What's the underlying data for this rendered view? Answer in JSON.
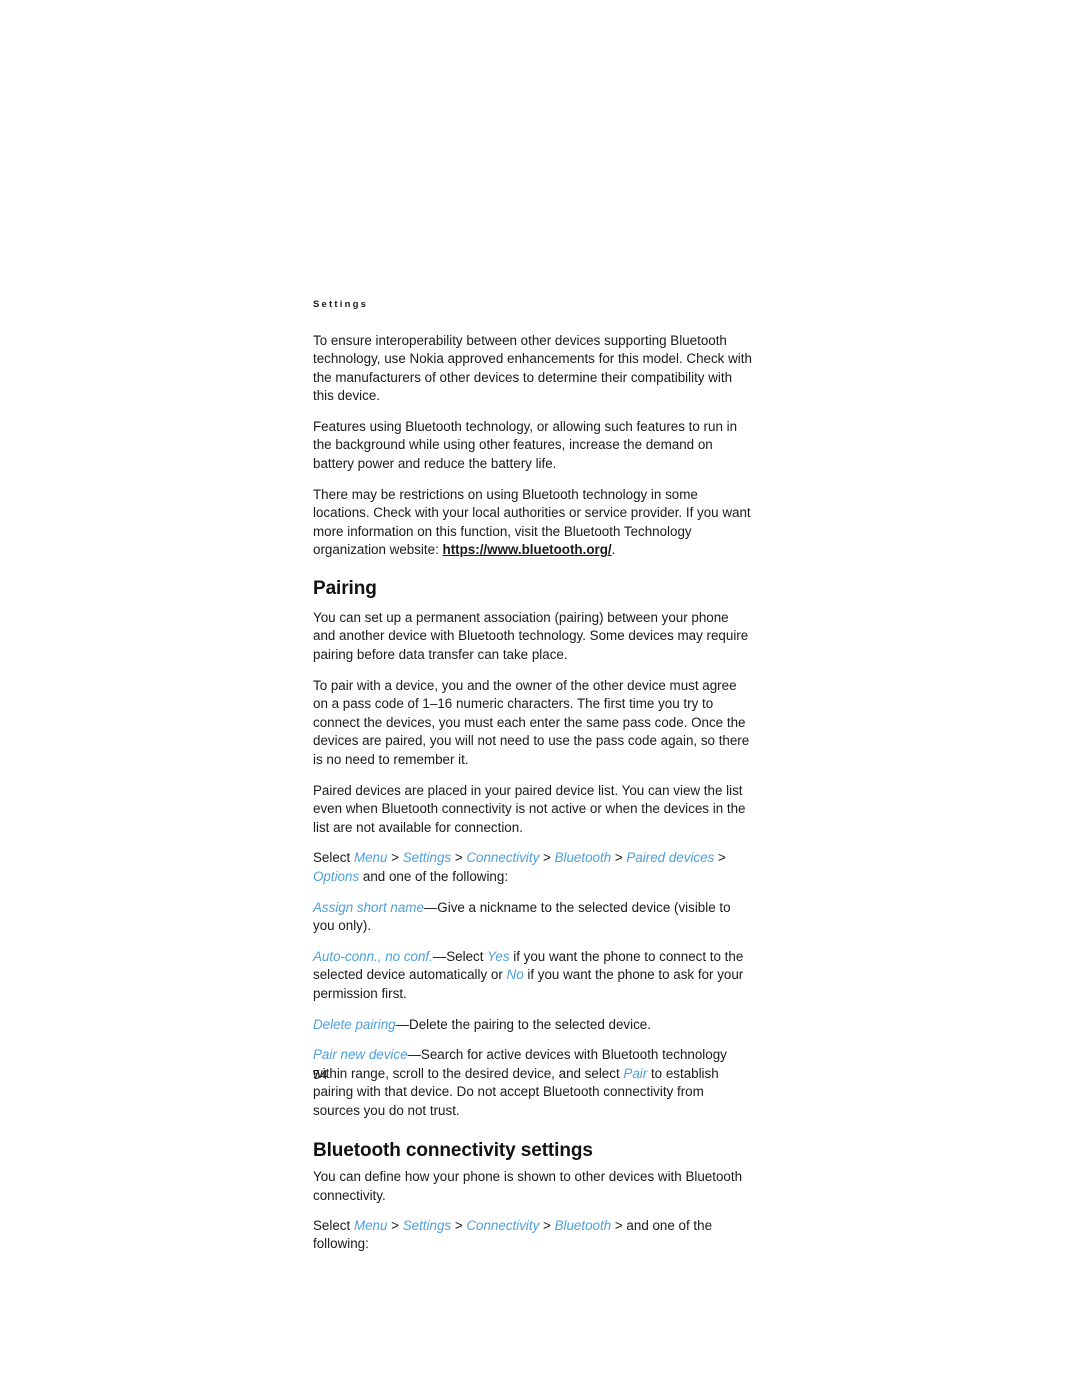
{
  "page": {
    "running_header": "Settings",
    "page_number": "54",
    "accent_color": "#4d9fdb",
    "text_color": "#1a1a1a"
  },
  "paragraphs": {
    "interoperability": "To ensure interoperability between other devices supporting Bluetooth technology, use Nokia approved enhancements for this model. Check with the manufacturers of other devices to determine their compatibility with this device.",
    "features_battery": "Features using Bluetooth technology, or allowing such features to run in the background while using other features, increase the demand on battery power and reduce the battery life.",
    "restrictions_prefix": "There may be restrictions on using Bluetooth technology in some locations. Check with your local authorities or service provider. If you want more information on this function, visit the Bluetooth Technology organization website: ",
    "restrictions_url": "https://www.bluetooth.org/",
    "restrictions_suffix": ".",
    "pairing_intro": "You can set up a permanent association (pairing) between your phone and another device with Bluetooth technology. Some devices may require pairing before data transfer can take place.",
    "pass_code": "To pair with a device, you and the owner of the other device must agree on a pass code of 1–16 numeric characters. The first time you try to connect the devices, you must each enter the same pass code. Once the devices are paired, you will not need to use the pass code again, so there is no need to remember it.",
    "paired_list": "Paired devices are placed in your paired device list. You can view the list even when Bluetooth connectivity is not active or when the devices in the list are not available for connection.",
    "bt_settings_intro": "You can define how your phone is shown to other devices with Bluetooth connectivity."
  },
  "headings": {
    "pairing": "Pairing",
    "bluetooth_connectivity_settings": "Bluetooth connectivity settings"
  },
  "menu_path_paired": {
    "select_label": "Select ",
    "items": [
      "Menu",
      "Settings",
      "Connectivity",
      "Bluetooth",
      "Paired devices",
      "Options"
    ],
    "separator": " > ",
    "tail": " and one of the following:"
  },
  "menu_path_bluetooth": {
    "select_label": "Select ",
    "items": [
      "Menu",
      "Settings",
      "Connectivity",
      "Bluetooth"
    ],
    "separator": " > ",
    "tail": " and one of the following:"
  },
  "options": {
    "assign_short_name": {
      "term": "Assign short name",
      "dash": "—",
      "description": "Give a nickname to the selected device (visible to you only)."
    },
    "auto_conn": {
      "term": "Auto-conn., no conf.",
      "dash": "—",
      "desc_part1": "Select ",
      "value_yes": "Yes",
      "desc_part2": " if you want the phone to connect to the selected device automatically or ",
      "value_no": "No",
      "desc_part3": " if you want the phone to ask for your permission first."
    },
    "delete_pairing": {
      "term": "Delete pairing",
      "dash": "—",
      "description": "Delete the pairing to the selected device."
    },
    "pair_new_device": {
      "term": "Pair new device",
      "dash": "—",
      "desc_part1": "Search for active devices with Bluetooth technology within range, scroll to the desired device, and select ",
      "value_pair": "Pair",
      "desc_part2": " to establish pairing with that device. Do not accept Bluetooth connectivity from sources you do not trust."
    }
  }
}
